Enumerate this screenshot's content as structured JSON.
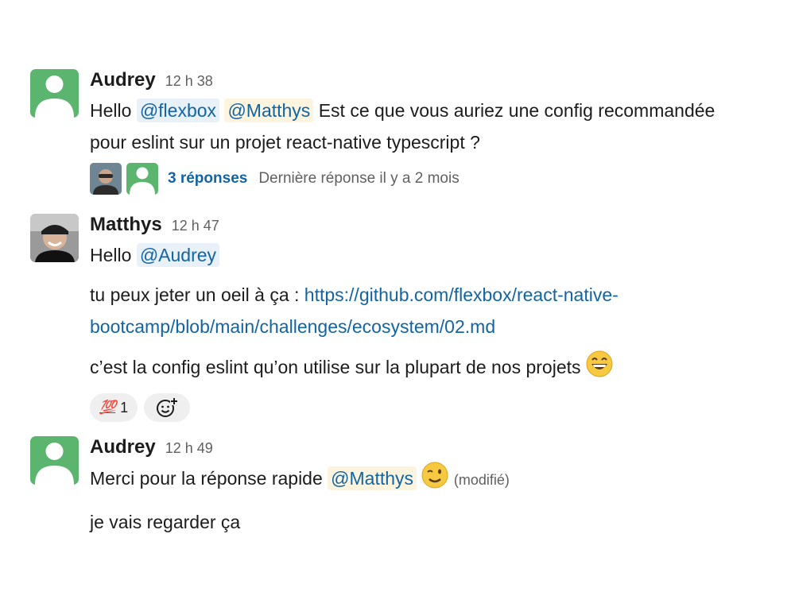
{
  "messages": [
    {
      "author": "Audrey",
      "time": "12 h 38",
      "line1": {
        "pre": "Hello ",
        "mention1": "@flexbox",
        "mention2": "@Matthys",
        "post": " Est ce que vous auriez une config recommandée"
      },
      "line2": "pour eslint sur un projet react-native typescript ?",
      "thread": {
        "replies": "3 réponses",
        "last_reply": "Dernière réponse il y a 2 mois"
      }
    },
    {
      "author": "Matthys",
      "time": "12 h 47",
      "line1": {
        "pre": "Hello ",
        "mention": "@Audrey"
      },
      "line2": {
        "pre": "tu peux jeter un oeil à ça : ",
        "link": "https://github.com/flexbox/react-native-"
      },
      "line3": {
        "link": "bootcamp/blob/main/challenges/ecosystem/02.md"
      },
      "line4": "c’est la config eslint qu’on utilise sur la plupart de nos projets",
      "reactions": [
        {
          "emoji": "💯",
          "icon": "hundred-points-emoji",
          "count": "1"
        }
      ],
      "add_reaction_icon": "add-reaction-icon"
    },
    {
      "author": "Audrey",
      "time": "12 h 49",
      "line1": {
        "pre": "Merci pour la réponse rapide ",
        "mention": "@Matthys",
        "edited": "(modifié)"
      },
      "line2": "je vais regarder ça"
    }
  ],
  "colors": {
    "mention_text": "#1264a3",
    "mention_bg_other": "#e8f0f8",
    "mention_bg_self": "#fdf4df",
    "default_avatar": "#5bb56e"
  }
}
